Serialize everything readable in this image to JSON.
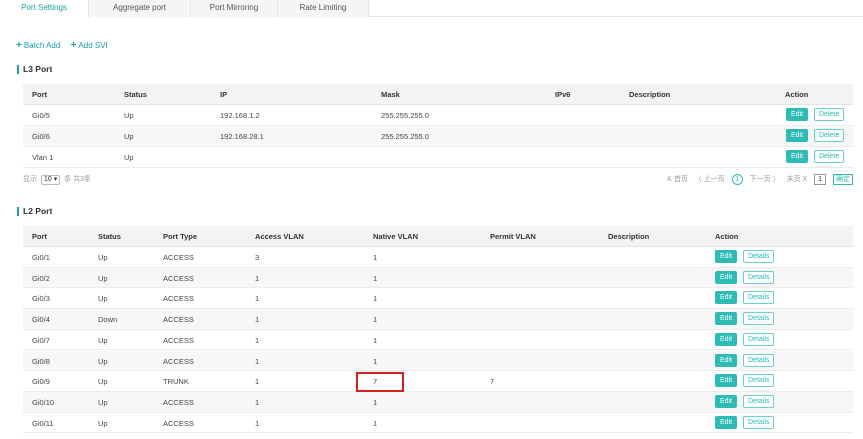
{
  "tabs": [
    "Port Settings",
    "Aggregate port",
    "Port Mirroring",
    "Rate Limiting"
  ],
  "toolbar": {
    "batch_add": "Batch Add",
    "add_svi": "Add SVI"
  },
  "l3": {
    "title": "L3 Port",
    "headers": [
      "Port",
      "Status",
      "IP",
      "Mask",
      "IPv6",
      "Description",
      "Action"
    ],
    "rows": [
      [
        "Gi0/5",
        "Up",
        "192.168.1.2",
        "255.255.255.0",
        "",
        ""
      ],
      [
        "Gi0/6",
        "Up",
        "192.168.28.1",
        "255.255.255.0",
        "",
        ""
      ],
      [
        "Vlan 1",
        "Up",
        "",
        "",
        "",
        ""
      ]
    ],
    "edit_label": "Edit",
    "delete_label": "Delete",
    "pager": {
      "show_label": "显示",
      "page_size": "10",
      "total_label": "条 共3条",
      "first": "K 首页",
      "prev": "〈 上一页",
      "current": "1",
      "next": "下一页 〉",
      "last": "末页 X",
      "jump_value": "1",
      "confirm": "确定"
    }
  },
  "l2": {
    "title": "L2 Port",
    "headers": [
      "Port",
      "Status",
      "Port Type",
      "Access VLAN",
      "Native VLAN",
      "Permit VLAN",
      "Description",
      "Action"
    ],
    "rows": [
      [
        "Gi0/1",
        "Up",
        "ACCESS",
        "3",
        "1",
        "",
        ""
      ],
      [
        "Gi0/2",
        "Up",
        "ACCESS",
        "1",
        "1",
        "",
        ""
      ],
      [
        "Gi0/3",
        "Up",
        "ACCESS",
        "1",
        "1",
        "",
        ""
      ],
      [
        "Gi0/4",
        "Down",
        "ACCESS",
        "1",
        "1",
        "",
        ""
      ],
      [
        "Gi0/7",
        "Up",
        "ACCESS",
        "1",
        "1",
        "",
        ""
      ],
      [
        "Gi0/8",
        "Up",
        "ACCESS",
        "1",
        "1",
        "",
        ""
      ],
      [
        "Gi0/9",
        "Up",
        "TRUNK",
        "1",
        "7",
        "7",
        ""
      ],
      [
        "Gi0/10",
        "Up",
        "ACCESS",
        "1",
        "1",
        "",
        ""
      ],
      [
        "Gi0/11",
        "Up",
        "ACCESS",
        "1",
        "1",
        "",
        ""
      ]
    ],
    "edit_label": "Edit",
    "details_label": "Details"
  },
  "colors": {
    "accent": "#2bbcb6",
    "highlight": "#d51f1f"
  }
}
